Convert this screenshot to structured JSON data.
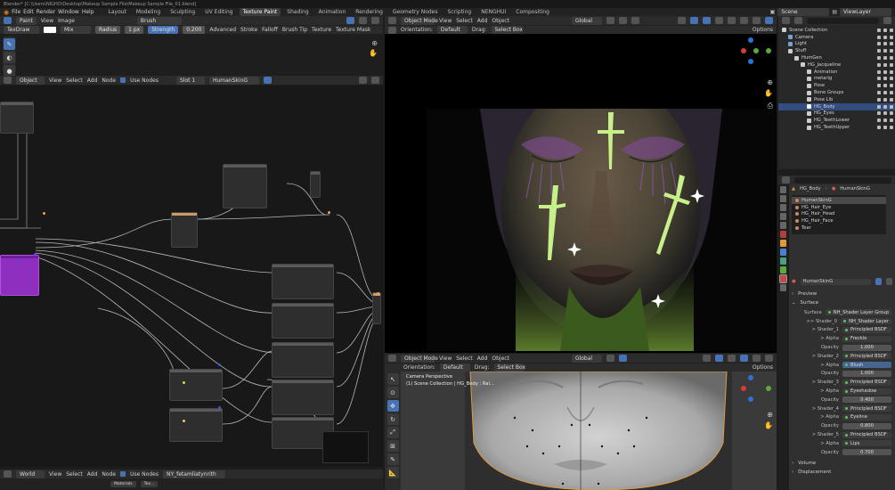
{
  "title_bar": "Blender* [C:\\Users\\NIGHO\\Desktop\\Makeup Sample File\\Makeup Sample File_01.blend]",
  "menu": [
    "File",
    "Edit",
    "Render",
    "Window",
    "Help"
  ],
  "workspaces": [
    "Layout",
    "Modeling",
    "Sculpting",
    "UV Editing",
    "Texture Paint",
    "Shading",
    "Animation",
    "Rendering",
    "Geometry Nodes",
    "Scripting",
    "NENGHUI",
    "Compositing"
  ],
  "active_workspace": "Texture Paint",
  "scene": {
    "label": "Scene",
    "view_layer": "ViewLayer"
  },
  "image_editor": {
    "header": {
      "mode": "Paint",
      "menus": [
        "View",
        "Image"
      ],
      "brush": "Brush"
    },
    "tool_header": {
      "tool": "TexDraw",
      "blend": "Mix",
      "radius_label": "Radius",
      "radius_value": "1 px",
      "strength_label": "Strength",
      "strength_value": "0.200",
      "dropdowns": [
        "Advanced",
        "Stroke",
        "Falloff",
        "Brush Tip",
        "Texture",
        "Texture Mask"
      ]
    }
  },
  "node_editor": {
    "header": {
      "type": "Object",
      "menus": [
        "View",
        "Select",
        "Add",
        "Node"
      ],
      "use_nodes": "Use Nodes",
      "slot": "Slot 1",
      "material": "HumanSkinG"
    },
    "bottom_header": {
      "type": "World",
      "menus": [
        "View",
        "Select",
        "Add",
        "Node"
      ],
      "use_nodes": "Use Nodes",
      "world": "NY_fetamliatynrith"
    },
    "footer_tabs": [
      "Materials",
      "Tex..."
    ]
  },
  "viewport_top": {
    "header": {
      "mode": "Object Mode",
      "menus": [
        "View",
        "Select",
        "Add",
        "Object"
      ],
      "orientation_global": "Global",
      "options": "Options"
    },
    "tool_header": {
      "orientation_label": "Orientation:",
      "orientation": "Default",
      "drag_label": "Drag:",
      "drag": "Select Box"
    }
  },
  "viewport_bottom": {
    "header": {
      "mode": "Object Mode",
      "menus": [
        "View",
        "Select",
        "Add",
        "Object"
      ],
      "orientation_global": "Global",
      "options": "Options"
    },
    "tool_header": {
      "orientation_label": "Orientation:",
      "orientation": "Default",
      "drag_label": "Drag:",
      "drag": "Select Box"
    },
    "overlay_line1": "Camera Perspective",
    "overlay_line2": "(1) Scene Collection | HG_Body : Rai..."
  },
  "outliner": {
    "items": [
      {
        "indent": 0,
        "label": "Scene Collection",
        "icon": "collection-icon",
        "color": "#cccccc"
      },
      {
        "indent": 1,
        "label": "Camera",
        "icon": "camera-icon",
        "color": "#7b9ed1"
      },
      {
        "indent": 1,
        "label": "Light",
        "icon": "light-icon",
        "color": "#7b9ed1"
      },
      {
        "indent": 1,
        "label": "Stuff",
        "icon": "collection-icon",
        "color": "#cccccc"
      },
      {
        "indent": 2,
        "label": "HumGen",
        "icon": "collection-icon",
        "color": "#cccccc"
      },
      {
        "indent": 3,
        "label": "HG_Jacqueline",
        "icon": "armature-icon",
        "color": "#cccccc"
      },
      {
        "indent": 4,
        "label": "Animation",
        "icon": "action-icon",
        "color": "#cccccc"
      },
      {
        "indent": 4,
        "label": "metarig",
        "icon": "armature-icon",
        "color": "#cccccc"
      },
      {
        "indent": 4,
        "label": "Pose",
        "icon": "pose-icon",
        "color": "#cccccc"
      },
      {
        "indent": 4,
        "label": "Bone Groups",
        "icon": "bone-icon",
        "color": "#cccccc"
      },
      {
        "indent": 4,
        "label": "Pose Lib",
        "icon": "poselib-icon",
        "color": "#cccccc"
      },
      {
        "indent": 4,
        "label": "HG_Body",
        "icon": "mesh-icon",
        "color": "#ffffff",
        "selected": true
      },
      {
        "indent": 4,
        "label": "HG_Eyes",
        "icon": "mesh-icon",
        "color": "#cccccc"
      },
      {
        "indent": 4,
        "label": "HG_TeethLower",
        "icon": "mesh-icon",
        "color": "#cccccc"
      },
      {
        "indent": 4,
        "label": "HG_TeethUpper",
        "icon": "mesh-icon",
        "color": "#cccccc"
      }
    ]
  },
  "properties": {
    "breadcrumb": [
      "HG_Body",
      "HumanSkinG"
    ],
    "material_slots": [
      {
        "label": "HumanSkinG",
        "selected": true
      },
      {
        "label": "HG_Hair_Eye"
      },
      {
        "label": "HG_Hair_Head"
      },
      {
        "label": "HG_Hair_Face"
      },
      {
        "label": "Tear"
      }
    ],
    "material_name": "HumanSkinG",
    "panels": {
      "preview": "Preview",
      "surface": "Surface",
      "volume": "Volume",
      "displacement": "Displacement"
    },
    "surface_rows": [
      {
        "label": "Surface",
        "value": "NH_Shader Layer Group",
        "kind": "shader"
      },
      {
        "label": ">> Shader_0",
        "value": "NH_Shader Layer",
        "kind": "shader"
      },
      {
        "label": "> Shader_1",
        "value": "Principled BSDF",
        "kind": "shader"
      },
      {
        "label": "> Alpha",
        "value": "Freckle",
        "kind": "shader"
      },
      {
        "label": "Opacity",
        "value": "1.000",
        "kind": "num"
      },
      {
        "label": "> Shader_2",
        "value": "Principled BSDF",
        "kind": "shader"
      },
      {
        "label": "> Alpha",
        "value": "Blush",
        "kind": "shader",
        "highlight": true
      },
      {
        "label": "Opacity",
        "value": "1.000",
        "kind": "num"
      },
      {
        "label": "> Shader_3",
        "value": "Principled BSDF",
        "kind": "shader"
      },
      {
        "label": "> Alpha",
        "value": "Eyeshadow",
        "kind": "shader"
      },
      {
        "label": "Opacity",
        "value": "0.400",
        "kind": "num"
      },
      {
        "label": "> Shader_4",
        "value": "Principled BSDF",
        "kind": "shader"
      },
      {
        "label": "> Alpha",
        "value": "Eyeline",
        "kind": "shader"
      },
      {
        "label": "Opacity",
        "value": "0.800",
        "kind": "num"
      },
      {
        "label": "> Shader_5",
        "value": "Principled BSDF",
        "kind": "shader"
      },
      {
        "label": "> Alpha",
        "value": "Lips",
        "kind": "shader"
      },
      {
        "label": "Opacity",
        "value": "0.700",
        "kind": "num"
      }
    ]
  },
  "colors": {
    "accent": "#4772b3",
    "selected_row": "#334d80",
    "header": "#2b2b2b",
    "panel": "#303030",
    "node_purple": "#9b2fc9"
  }
}
